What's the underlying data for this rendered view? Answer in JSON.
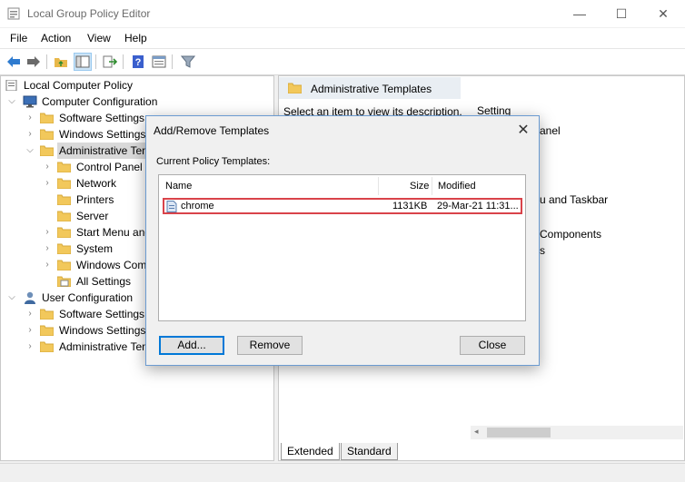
{
  "window": {
    "title": "Local Group Policy Editor",
    "minimize_glyph": "—",
    "maximize_glyph": "☐",
    "close_glyph": "✕"
  },
  "menu": [
    "File",
    "Action",
    "View",
    "Help"
  ],
  "toolbar_icons": [
    "back-arrow-icon",
    "forward-arrow-icon",
    "up-folder-icon",
    "show-hide-tree-icon",
    "export-list-icon",
    "help-icon",
    "properties-icon",
    "filter-icon"
  ],
  "tree": {
    "root": "Local Computer Policy",
    "computer_configuration": "Computer Configuration",
    "cc_software_settings": "Software Settings",
    "cc_windows_settings": "Windows Settings",
    "cc_admin_templates": "Administrative Templates",
    "control_panel": "Control Panel",
    "network": "Network",
    "printers": "Printers",
    "server": "Server",
    "start_menu": "Start Menu and Taskbar",
    "system": "System",
    "windows_components": "Windows Components",
    "all_settings": "All Settings",
    "user_configuration": "User Configuration",
    "uc_software_settings": "Software Settings",
    "uc_windows_settings": "Windows Settings",
    "uc_admin_templates": "Administrative Templates"
  },
  "right_pane": {
    "header": "Administrative Templates",
    "description": "Select an item to view its description.",
    "column_setting": "Setting",
    "items_visible": [
      "anel",
      "u and Taskbar",
      "Components",
      "s"
    ],
    "tabs": [
      "Extended",
      "Standard"
    ]
  },
  "dialog": {
    "title": "Add/Remove Templates",
    "close_glyph": "✕",
    "label": "Current Policy Templates:",
    "columns": {
      "name": "Name",
      "size": "Size",
      "modified": "Modified"
    },
    "rows": [
      {
        "name": "chrome",
        "size": "1131KB",
        "modified": "29-Mar-21 11:31..."
      }
    ],
    "buttons": {
      "add": "Add...",
      "remove": "Remove",
      "close": "Close"
    }
  },
  "colors": {
    "highlight_border": "#d9434a",
    "dialog_border": "#6b9bd1",
    "selection_bg": "#d9d9d9"
  }
}
